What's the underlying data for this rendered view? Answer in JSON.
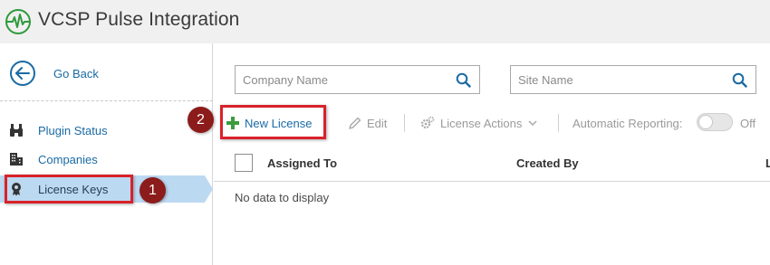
{
  "header": {
    "title": "VCSP Pulse Integration",
    "logo_icon": "pulse-logo-icon",
    "brand_color": "#2f9a3c"
  },
  "sidebar": {
    "back": {
      "label": "Go Back",
      "icon": "arrow-left-circle-icon"
    },
    "items": [
      {
        "label": "Plugin Status",
        "icon": "binoculars-icon"
      },
      {
        "label": "Companies",
        "icon": "building-icon"
      },
      {
        "label": "License Keys",
        "icon": "license-badge-icon",
        "active": true
      }
    ],
    "active_color": "#bcd9f2"
  },
  "filters": {
    "company": {
      "placeholder": "Company Name",
      "value": ""
    },
    "site": {
      "placeholder": "Site Name",
      "value": ""
    }
  },
  "toolbar": {
    "new_license": "New License",
    "edit": "Edit",
    "license_actions": "License Actions",
    "automatic_reporting": "Automatic Reporting:",
    "toggle_state": "Off"
  },
  "grid": {
    "columns": [
      "Assigned To",
      "Created By",
      "L"
    ],
    "empty_message": "No data to display"
  },
  "annotations": {
    "step1": "1",
    "step2": "2",
    "highlight_color": "#d9222a",
    "badge_color": "#8c1b1b"
  },
  "link_color": "#1a6aa4"
}
